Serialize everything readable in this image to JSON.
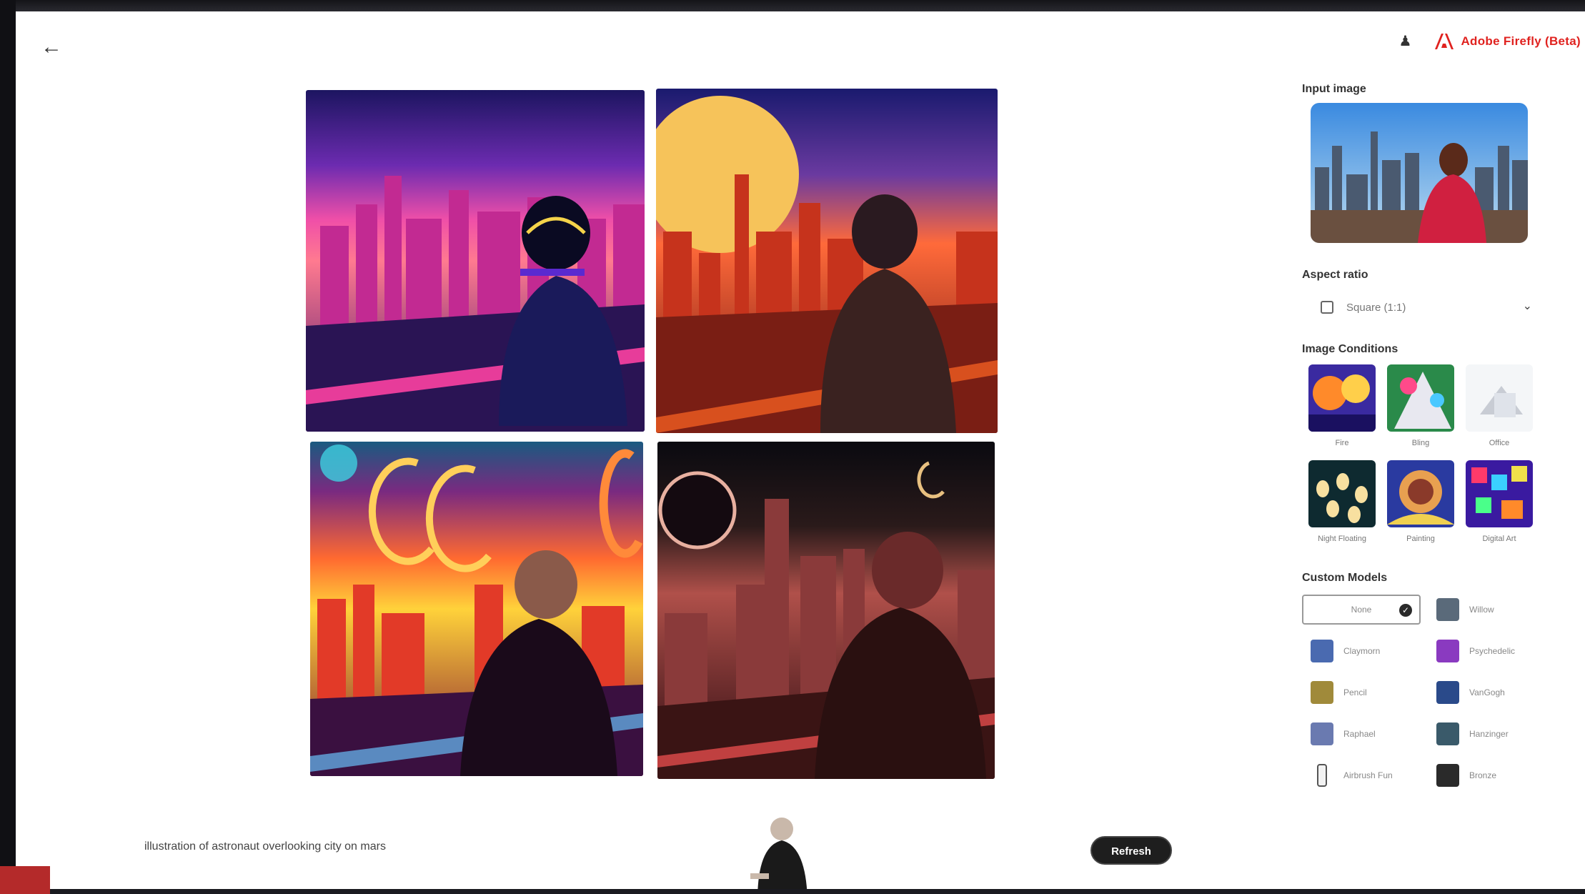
{
  "header": {
    "back_icon": "arrow-left-icon",
    "profile_icon": "person-icon",
    "brand_name": "Adobe Firefly (Beta)",
    "brand_color": "#e0221f"
  },
  "main": {
    "prompt": "illustration of astronaut overlooking city on mars",
    "refresh_label": "Refresh"
  },
  "panel": {
    "input_image_label": "Input image",
    "aspect_ratio_label": "Aspect ratio",
    "aspect_ratio_value": "Square (1:1)",
    "image_conditions_label": "Image Conditions",
    "image_conditions": [
      {
        "label": "Fire"
      },
      {
        "label": "Bling"
      },
      {
        "label": "Office"
      },
      {
        "label": "Night Floating"
      },
      {
        "label": "Painting"
      },
      {
        "label": "Digital Art"
      }
    ],
    "custom_models_label": "Custom Models",
    "custom_models": [
      {
        "label": "None",
        "selected": true
      },
      {
        "label": "Willow"
      },
      {
        "label": "Claymorn"
      },
      {
        "label": "Psychedelic"
      },
      {
        "label": "Pencil"
      },
      {
        "label": "VanGogh"
      },
      {
        "label": "Raphael"
      },
      {
        "label": "Hanzinger"
      },
      {
        "label": "Airbrush Fun"
      },
      {
        "label": "Bronze"
      }
    ]
  }
}
